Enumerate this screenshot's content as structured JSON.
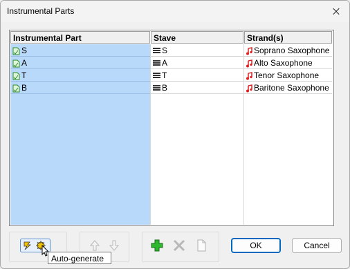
{
  "window": {
    "title": "Instrumental Parts"
  },
  "grid": {
    "headers": [
      "Instrumental Part",
      "Stave",
      "Strand(s)"
    ],
    "rows": [
      {
        "part": "S",
        "stave": "S",
        "strand": "Soprano Saxophone"
      },
      {
        "part": "A",
        "stave": "A",
        "strand": "Alto Saxophone"
      },
      {
        "part": "T",
        "stave": "T",
        "strand": "Tenor Saxophone"
      },
      {
        "part": "B",
        "stave": "B",
        "strand": "Baritone Saxophone"
      }
    ]
  },
  "buttons": {
    "ok": "OK",
    "cancel": "Cancel"
  },
  "tooltip": "Auto-generate",
  "icons": {
    "part": "part-document-icon",
    "stave": "stave-icon",
    "strand": "music-note-icon",
    "auto_generate": "auto-generate-icon",
    "move_up": "arrow-up-icon",
    "move_down": "arrow-down-icon",
    "add": "plus-icon",
    "delete": "delete-x-icon",
    "properties": "document-icon"
  },
  "colors": {
    "selection": "#b9d9fb",
    "accent": "#0067c0",
    "note": "#e02020",
    "add": "#2db82d"
  }
}
